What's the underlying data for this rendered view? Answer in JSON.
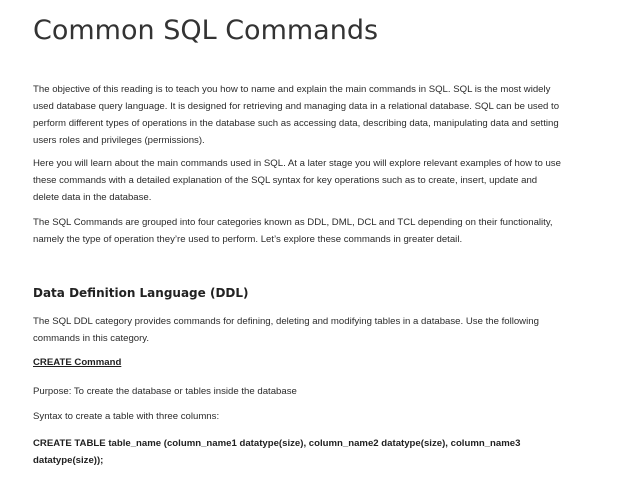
{
  "page": {
    "title": "Common SQL Commands"
  },
  "intro": {
    "paragraphs": [
      "The objective of this reading is to teach you how to name and explain the main commands in SQL. SQL is the most widely used database query language. It is designed for retrieving and managing data in a relational database. SQL can be used to perform different types of operations in the database such as accessing data, describing data, manipulating data and setting users roles and privileges (permissions).",
      "Here you will learn about the main commands used in SQL. At a later stage you will explore relevant examples of how to use these commands with a detailed explanation of the SQL syntax for key operations such as to create, insert, update and delete data in the database.",
      "The SQL Commands are grouped into four categories known as DDL, DML, DCL and TCL depending on their functionality, namely the type of operation they’re used to perform.  Let’s explore these commands in greater detail."
    ]
  },
  "ddl": {
    "heading": "Data Definition Language (DDL)",
    "description": "The SQL DDL category provides commands for defining, deleting and modifying tables in a database. Use the following commands in this category.",
    "create": {
      "heading": "CREATE Command",
      "purpose": "Purpose: To create the database or tables inside the database",
      "syntax_intro": "Syntax to create a table with three columns:",
      "syntax": "CREATE TABLE table_name (column_name1 datatype(size), column_name2 datatype(size), column_name3 datatype(size));"
    }
  }
}
